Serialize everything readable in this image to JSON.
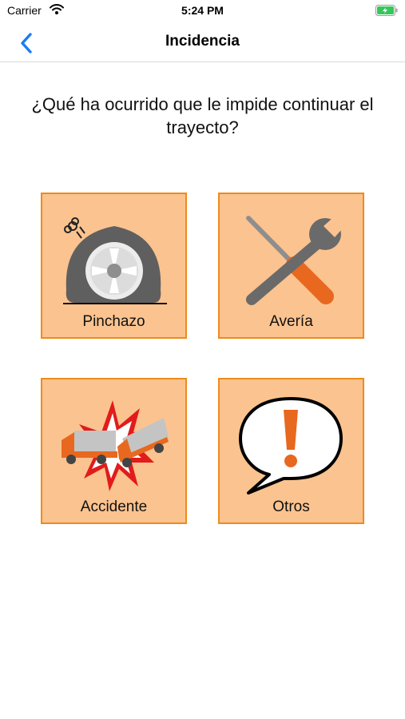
{
  "status_bar": {
    "carrier": "Carrier",
    "time": "5:24 PM"
  },
  "nav": {
    "title": "Incidencia",
    "back_icon": "chevron-left-icon"
  },
  "question": "¿Qué ha ocurrido que le impide continuar el trayecto?",
  "options": [
    {
      "label": "Pinchazo",
      "icon": "flat-tire-icon"
    },
    {
      "label": "Avería",
      "icon": "wrench-screwdriver-icon"
    },
    {
      "label": "Accidente",
      "icon": "truck-crash-icon"
    },
    {
      "label": "Otros",
      "icon": "exclamation-bubble-icon"
    }
  ],
  "colors": {
    "tile_fill": "#fbc38f",
    "tile_border": "#ee8b1c",
    "accent": "#1a7cf5",
    "icon_orange": "#e8681f"
  }
}
